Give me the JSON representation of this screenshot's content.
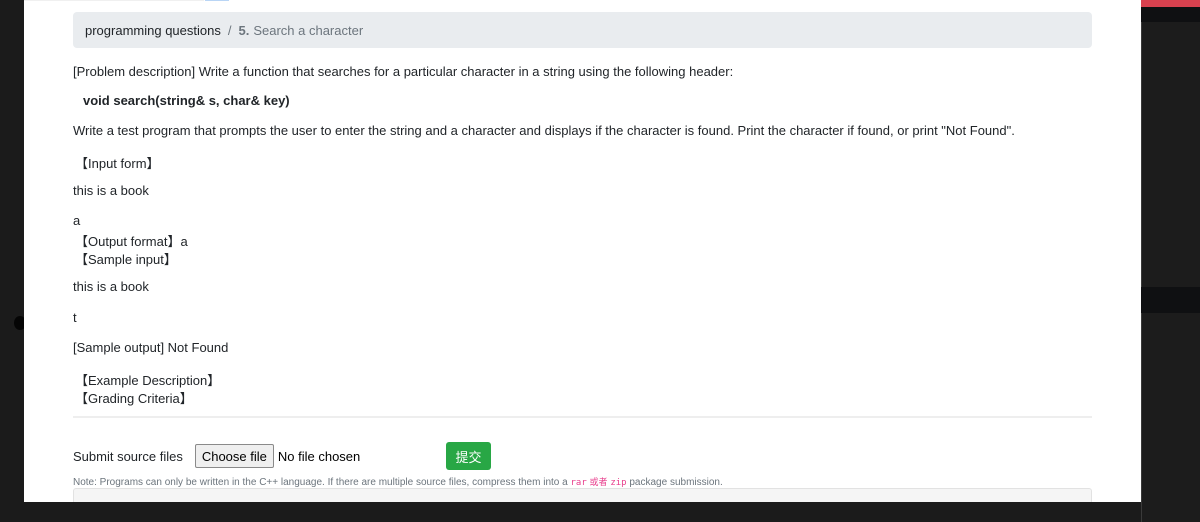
{
  "breadcrumb": {
    "parent": "programming questions",
    "separator": "/",
    "number": "5.",
    "current": "Search a character"
  },
  "problem": {
    "description": "[Problem description] Write a function that searches for a particular character in a string using the following header:",
    "header_code": "void search(string& s, char& key)",
    "instructions": "Write a test program that prompts the user to enter the string and a character and displays if the character is found. Print the character if found, or print \"Not Found\".",
    "input_form_label": "【Input form】",
    "input_form_line1": "this is a book",
    "input_form_line2": "a",
    "output_format": "【Output format】a",
    "sample_input_label": "【Sample input】",
    "sample_input_line1": "this is a book",
    "sample_input_line2": "t",
    "sample_output": "[Sample output] Not Found",
    "example_description_label": "【Example Description】",
    "grading_criteria_label": "【Grading Criteria】"
  },
  "submit": {
    "label": "Submit source files",
    "choose_file_button": "Choose file",
    "file_status": "No file chosen",
    "submit_button": "提交"
  },
  "note": {
    "prefix": "Note: Programs can only be written in the C++ language. If there are multiple source files, compress them into a ",
    "code_rar": "rar",
    "code_or": "或者",
    "code_zip": "zip",
    "suffix": " package submission."
  },
  "colors": {
    "accent_red": "#d8414f",
    "submit_green": "#28a745",
    "code_pink": "#e83e8c",
    "breadcrumb_bg": "#e9ecef"
  }
}
